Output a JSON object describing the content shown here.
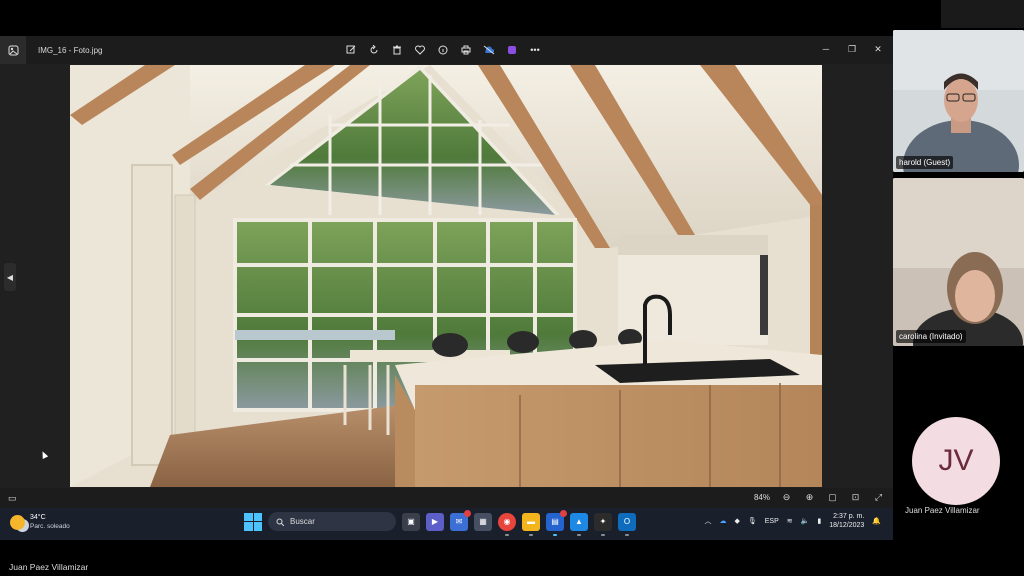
{
  "viewer": {
    "filename": "IMG_16 - Foto.jpg",
    "toolbar_icons": [
      "edit-icon",
      "rotate-icon",
      "delete-icon",
      "favorite-icon",
      "info-icon",
      "print-icon",
      "cloud-off-icon",
      "clipchamp-icon",
      "more-icon"
    ],
    "zoom": "84%"
  },
  "taskbar": {
    "temperature": "34°C",
    "condition": "Parc. soleado",
    "search_placeholder": "Buscar",
    "language": "ESP",
    "time": "2:37 p. m.",
    "date": "18/12/2023"
  },
  "participants": {
    "harold": "harold (Guest)",
    "carolina": "carolina (Invitado)",
    "juan_initials": "JV",
    "juan_name": "Juan  Paez Villamizar"
  },
  "presenter": "Juan  Paez Villamizar",
  "colors": {
    "accent": "#4cc2ff",
    "avatar_bg": "#f3dde3",
    "avatar_fg": "#6b2b3a"
  }
}
